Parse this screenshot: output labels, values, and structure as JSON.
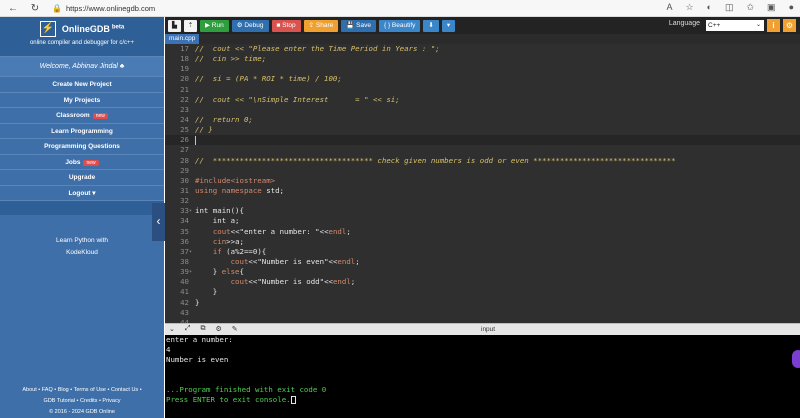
{
  "browser": {
    "url": "https://www.onlinegdb.com",
    "back_icon": "back-arrow-icon",
    "refresh_icon": "refresh-icon"
  },
  "sidebar": {
    "logo_text": "OnlineGDB",
    "logo_beta": "beta",
    "logo_sub": "online compiler and debugger for c/c++",
    "welcome": "Welcome, Abhinav Jindal ♣",
    "items": [
      {
        "label": "Create New Project",
        "badge": ""
      },
      {
        "label": "My Projects",
        "badge": ""
      },
      {
        "label": "Classroom",
        "badge": "new"
      },
      {
        "label": "Learn Programming",
        "badge": ""
      },
      {
        "label": "Programming Questions",
        "badge": ""
      },
      {
        "label": "Jobs",
        "badge": "new"
      },
      {
        "label": "Upgrade",
        "badge": ""
      },
      {
        "label": "Logout ▾",
        "badge": ""
      }
    ],
    "promo_line1": "Learn Python with",
    "promo_line2": "KodeKloud",
    "footer_line1": "About • FAQ • Blog • Terms of Use • Contact Us •",
    "footer_line2": "GDB Tutorial • Credits • Privacy",
    "footer_line3": "© 2016 - 2024 GDB Online"
  },
  "toolbar": {
    "run": "▶ Run",
    "debug": "⚙ Debug",
    "stop": "■ Stop",
    "share": "⇪ Share",
    "save": "💾 Save",
    "beautify": "{ } Beautify",
    "download": "⬇",
    "download_menu": "▾",
    "language_label": "Language",
    "language_value": "C++"
  },
  "editor": {
    "filename": "main.cpp",
    "lines": [
      {
        "n": "17",
        "fold": "",
        "html": "<span class=\"cm\">//  cout &lt;&lt; \"Please enter the Time Period in Years : \";</span>"
      },
      {
        "n": "18",
        "fold": "",
        "html": "<span class=\"cm\">//  cin &gt;&gt; time;</span>"
      },
      {
        "n": "19",
        "fold": "",
        "html": ""
      },
      {
        "n": "20",
        "fold": "",
        "html": "<span class=\"cm\">//  si = (PA * ROI * time) / 100;</span>"
      },
      {
        "n": "21",
        "fold": "",
        "html": ""
      },
      {
        "n": "22",
        "fold": "",
        "html": "<span class=\"cm\">//  cout &lt;&lt; \"\\nSimple Interest      = \" &lt;&lt; si;</span>"
      },
      {
        "n": "23",
        "fold": "",
        "html": ""
      },
      {
        "n": "24",
        "fold": "",
        "html": "<span class=\"cm\">//  return 0;</span>"
      },
      {
        "n": "25",
        "fold": "",
        "html": "<span class=\"cm\">// }</span>"
      },
      {
        "n": "26",
        "fold": "",
        "html": "<span class=\"cursor-bar\"></span>",
        "current": true
      },
      {
        "n": "27",
        "fold": "",
        "html": ""
      },
      {
        "n": "28",
        "fold": "",
        "html": "<span class=\"cm\">//  ************************************ check given numbers is odd or even ********************************</span>"
      },
      {
        "n": "29",
        "fold": "",
        "html": ""
      },
      {
        "n": "30",
        "fold": "",
        "html": "<span class=\"kw\">#include&lt;iostream&gt;</span>"
      },
      {
        "n": "31",
        "fold": "",
        "html": "<span class=\"kw\">using namespace</span> std;"
      },
      {
        "n": "32",
        "fold": "",
        "html": ""
      },
      {
        "n": "33",
        "fold": "▾",
        "html": "int main(){"
      },
      {
        "n": "34",
        "fold": "",
        "html": "    int a;"
      },
      {
        "n": "35",
        "fold": "",
        "html": "    <span class=\"kw\">cout</span>&lt;&lt;\"enter a number: \"&lt;&lt;<span class=\"kw\">endl</span>;"
      },
      {
        "n": "36",
        "fold": "",
        "html": "    <span class=\"kw\">cin</span>&gt;&gt;a;"
      },
      {
        "n": "37",
        "fold": "▾",
        "html": "    <span class=\"kw\">if</span> (a%2==0){"
      },
      {
        "n": "38",
        "fold": "",
        "html": "        <span class=\"kw\">cout</span>&lt;&lt;\"Number is even\"&lt;&lt;<span class=\"kw\">endl</span>;"
      },
      {
        "n": "39",
        "fold": "▾",
        "html": "    } <span class=\"kw\">else</span>{"
      },
      {
        "n": "40",
        "fold": "",
        "html": "        <span class=\"kw\">cout</span>&lt;&lt;\"Number is odd\"&lt;&lt;<span class=\"kw\">endl</span>;"
      },
      {
        "n": "41",
        "fold": "",
        "html": "    }"
      },
      {
        "n": "42",
        "fold": "",
        "html": "}"
      },
      {
        "n": "43",
        "fold": "",
        "html": ""
      },
      {
        "n": "44",
        "fold": "",
        "html": ""
      }
    ]
  },
  "io": {
    "title": "input"
  },
  "console": {
    "lines": [
      {
        "text": "enter a number:",
        "cls": ""
      },
      {
        "text": "4",
        "cls": ""
      },
      {
        "text": "Number is even",
        "cls": ""
      },
      {
        "text": "",
        "cls": ""
      },
      {
        "text": "",
        "cls": ""
      },
      {
        "text": "...Program finished with exit code 0",
        "cls": "green"
      },
      {
        "text": "Press ENTER to exit console.",
        "cls": "green",
        "cursor": true
      }
    ]
  }
}
